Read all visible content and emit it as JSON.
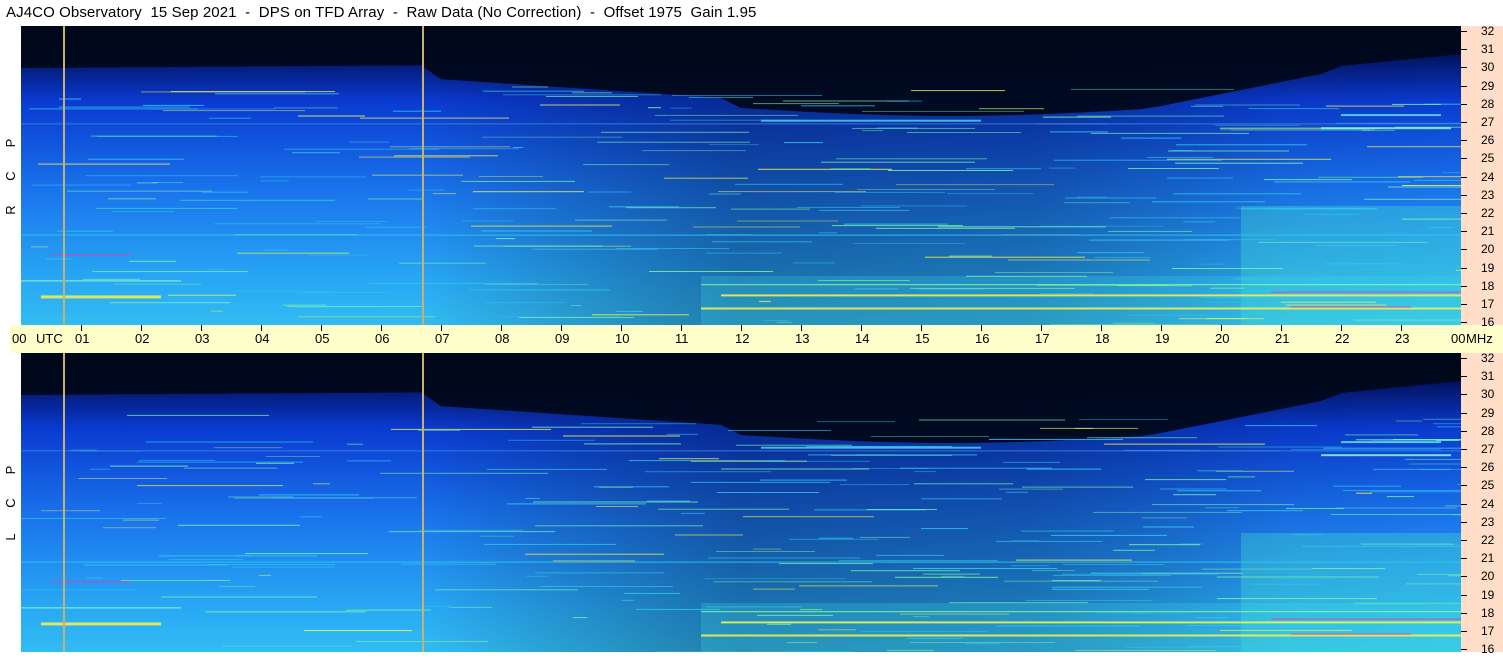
{
  "header": {
    "title": "AJ4CO Observatory  15 Sep 2021  -  DPS on TFD Array  -  Raw Data (No Correction)  -  Offset 1975  Gain 1.95"
  },
  "panels": [
    {
      "id": "rcp",
      "polarization_letters": [
        "R",
        "C",
        "P"
      ]
    },
    {
      "id": "lcp",
      "polarization_letters": [
        "L",
        "C",
        "P"
      ]
    }
  ],
  "time_axis": {
    "start_label": "00",
    "unit_label": "UTC",
    "hour_labels": [
      "01",
      "02",
      "03",
      "04",
      "05",
      "06",
      "07",
      "08",
      "09",
      "10",
      "11",
      "12",
      "13",
      "14",
      "15",
      "16",
      "17",
      "18",
      "19",
      "20",
      "21",
      "22",
      "23"
    ],
    "end_label": "00",
    "freq_unit": "MHz"
  },
  "frequency_axis": {
    "labels": [
      "32",
      "31",
      "30",
      "29",
      "28",
      "27",
      "26",
      "25",
      "24",
      "23",
      "22",
      "21",
      "20",
      "19",
      "18",
      "17",
      "16"
    ],
    "range_mhz": [
      16,
      32
    ]
  },
  "colors": {
    "background_dark": "#000010",
    "ionosphere_blue": "#0a3fd0",
    "band_blue": "#1f8ff0",
    "band_cyan": "#30c8f0",
    "signal_yellow": "#f0f050",
    "signal_magenta": "#e040b0",
    "time_axis_bg": "#ffffcc",
    "freq_axis_bg": "#ffddc8",
    "marker_line": "#c8b070"
  },
  "markers_utc_hours": [
    0.72,
    6.7
  ]
}
